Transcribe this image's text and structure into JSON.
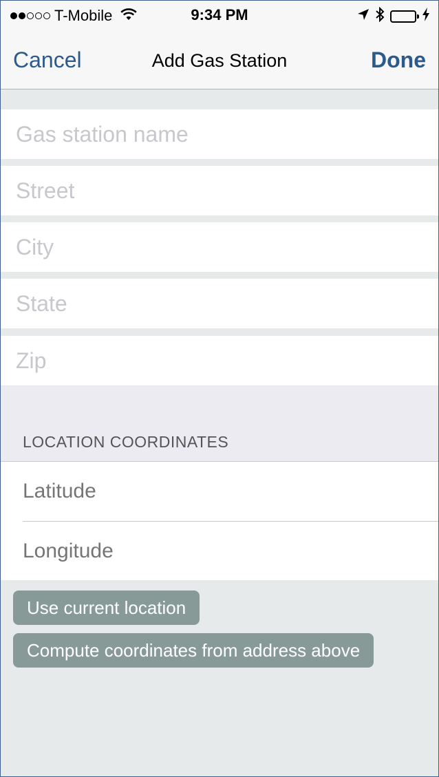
{
  "status_bar": {
    "carrier": "T-Mobile",
    "time": "9:34 PM",
    "signal_bars_filled": 2,
    "signal_bars_total": 5,
    "battery_color": "#4cd964"
  },
  "nav": {
    "cancel_label": "Cancel",
    "title": "Add Gas Station",
    "done_label": "Done",
    "accent_color": "#2b5a8c"
  },
  "form": {
    "name_placeholder": "Gas station name",
    "street_placeholder": "Street",
    "city_placeholder": "City",
    "state_placeholder": "State",
    "zip_placeholder": "Zip"
  },
  "location": {
    "section_title": "LOCATION COORDINATES",
    "latitude_placeholder": "Latitude",
    "longitude_placeholder": "Longitude",
    "use_current_label": "Use current location",
    "compute_label": "Compute coordinates from address above"
  },
  "icons": [
    "wifi-icon",
    "location-arrow-icon",
    "bluetooth-icon",
    "battery-icon",
    "charging-icon"
  ]
}
